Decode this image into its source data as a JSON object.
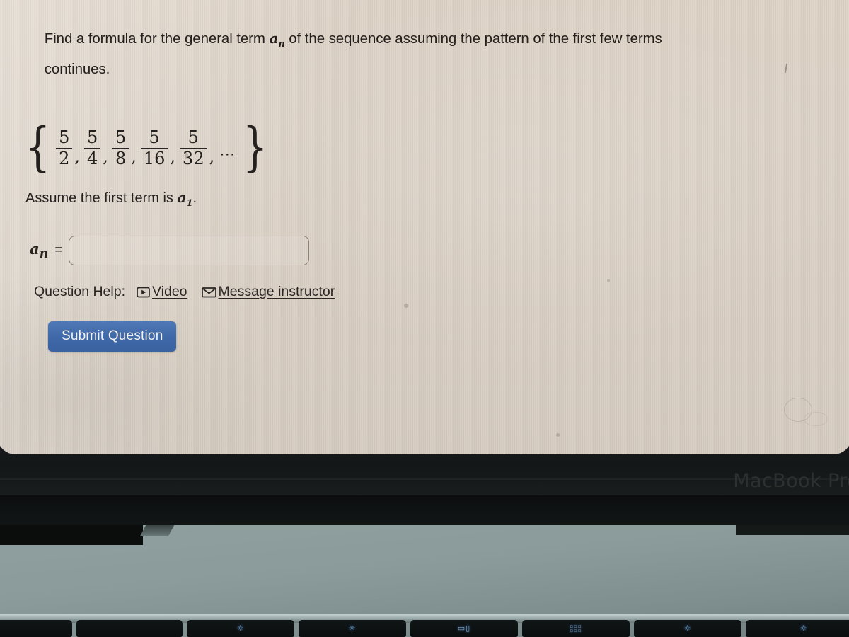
{
  "screen": {
    "prompt_line1": "Find a formula for the general term ",
    "prompt_var": "a",
    "prompt_var_sub": "n",
    "prompt_line1b": " of the sequence assuming the pattern of the first few terms",
    "prompt_line2": "continues.",
    "sequence": {
      "open_brace": "{",
      "close_brace": "}",
      "numerators": [
        "5",
        "5",
        "5",
        "5",
        "5"
      ],
      "denominators": [
        "2",
        "4",
        "8",
        "16",
        "32"
      ],
      "separator": ",",
      "ellipsis": "⋯"
    },
    "assume_text_pre": "Assume the first term is ",
    "assume_var": "a",
    "assume_var_sub": "1",
    "assume_text_post": ".",
    "answer": {
      "label_var": "a",
      "label_sub": "n",
      "equals": "=",
      "value": "",
      "placeholder": ""
    },
    "help": {
      "label": "Question Help:",
      "video_label": "Video",
      "video_icon": "play-video-icon",
      "message_label": "Message instructor",
      "message_icon": "envelope-icon"
    },
    "submit_label": "Submit Question",
    "colors": {
      "submit_blue": "#3f68a8",
      "screen_bg": "#dcd2c6",
      "text": "#241f1c",
      "input_border": "#8b8179"
    }
  },
  "hardware": {
    "brand_label": "MacBook Pro",
    "body_color": "#8b9b9b",
    "bezel_color": "#17191a",
    "function_keys": [
      {
        "glyph": "",
        "name": "function-key-blank-1"
      },
      {
        "glyph": "",
        "name": "function-key-blank-2"
      },
      {
        "glyph": "☀",
        "name": "keyboard-brightness-key"
      },
      {
        "glyph": "▭▯",
        "name": "mission-control-key"
      },
      {
        "glyph": "grid",
        "name": "launchpad-key"
      },
      {
        "glyph": "☀",
        "name": "brightness-down-key"
      },
      {
        "glyph": "☀",
        "name": "brightness-up-key"
      }
    ]
  }
}
